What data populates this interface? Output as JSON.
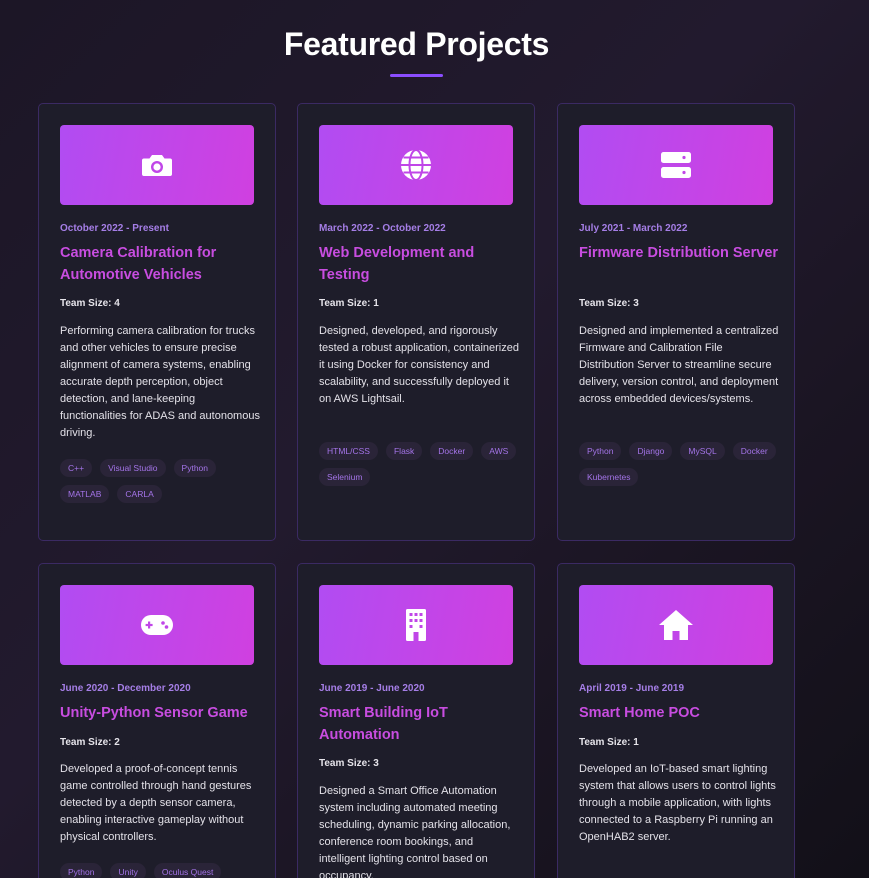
{
  "header": {
    "title": "Featured Projects"
  },
  "projects": [
    {
      "icon": "camera-icon",
      "date": "October 2022 - Present",
      "title": "Camera Calibration for Automotive Vehicles",
      "team": "Team Size: 4",
      "description": "Performing camera calibration for trucks and other vehicles to ensure precise alignment of camera systems, enabling accurate depth perception, object detection, and lane-keeping functionalities for ADAS and autonomous driving.",
      "tags": [
        "C++",
        "Visual Studio",
        "Python",
        "MATLAB",
        "CARLA"
      ]
    },
    {
      "icon": "globe-icon",
      "date": "March 2022 - October 2022",
      "title": "Web Development and Testing",
      "team": "Team Size: 1",
      "description": "Designed, developed, and rigorously tested a robust application, containerized it using Docker for consistency and scalability, and successfully deployed it on AWS Lightsail.",
      "tags": [
        "HTML/CSS",
        "Flask",
        "Docker",
        "AWS",
        "Selenium"
      ]
    },
    {
      "icon": "server-icon",
      "date": "July 2021 - March 2022",
      "title": "Firmware Distribution Server",
      "team": "Team Size: 3",
      "description": "Designed and implemented a centralized Firmware and Calibration File Distribution Server to streamline secure delivery, version control, and deployment across embedded devices/systems.",
      "tags": [
        "Python",
        "Django",
        "MySQL",
        "Docker",
        "Kubernetes"
      ]
    },
    {
      "icon": "gamepad-icon",
      "date": "June 2020 - December 2020",
      "title": "Unity-Python Sensor Game",
      "team": "Team Size: 2",
      "description": "Developed a proof-of-concept tennis game controlled through hand gestures detected by a depth sensor camera, enabling interactive gameplay without physical controllers.",
      "tags": [
        "Python",
        "Unity",
        "Oculus Quest"
      ]
    },
    {
      "icon": "building-icon",
      "date": "June 2019 - June 2020",
      "title": "Smart Building IoT Automation",
      "team": "Team Size: 3",
      "description": "Designed a Smart Office Automation system including automated meeting scheduling, dynamic parking allocation, conference room bookings, and intelligent lighting control based on occupancy.",
      "tags": []
    },
    {
      "icon": "home-icon",
      "date": "April 2019 - June 2019",
      "title": "Smart Home POC",
      "team": "Team Size: 1",
      "description": "Developed an IoT-based smart lighting system that allows users to control lights through a mobile application, with lights connected to a Raspberry Pi running an OpenHAB2 server.",
      "tags": []
    }
  ],
  "colors": {
    "accent": "#8b4dff",
    "card_title": "#c84de0",
    "date": "#a57ee6",
    "banner_from": "#b14cf2",
    "banner_to": "#d040e0"
  }
}
